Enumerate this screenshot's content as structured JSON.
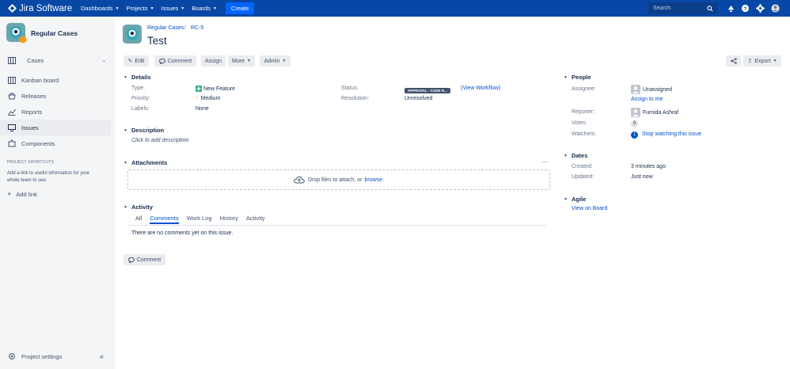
{
  "topbar": {
    "app_title": "Jira Software",
    "nav": [
      "Dashboards",
      "Projects",
      "Issues",
      "Boards"
    ],
    "create_label": "Create",
    "search_placeholder": "Search"
  },
  "sidebar": {
    "project_name": "Regular Cases",
    "items": [
      {
        "label": "Cases"
      },
      {
        "label": "Kanban board"
      },
      {
        "label": "Releases"
      },
      {
        "label": "Reports"
      },
      {
        "label": "Issues"
      },
      {
        "label": "Components"
      }
    ],
    "shortcuts_header": "PROJECT SHORTCUTS",
    "shortcuts_text": "Add a link to useful information for your whole team to see.",
    "add_link": "Add link",
    "settings": "Project settings"
  },
  "breadcrumb": {
    "project": "Regular Cases",
    "separator": "/",
    "issue_key": "RC-5"
  },
  "issue": {
    "title": "Test"
  },
  "toolbar": {
    "edit": "Edit",
    "comment": "Comment",
    "assign": "Assign",
    "more": "More",
    "admin": "Admin",
    "export": "Export"
  },
  "details": {
    "header": "Details",
    "type_label": "Type:",
    "type_value": "New Feature",
    "priority_label": "Priority:",
    "priority_value": "Medium",
    "labels_label": "Labels:",
    "labels_value": "None",
    "status_label": "Status:",
    "status_value": "APPROVAL - CODE R...",
    "view_workflow": "(View Workflow)",
    "resolution_label": "Resolution:",
    "resolution_value": "Unresolved"
  },
  "description": {
    "header": "Description",
    "placeholder": "Click to add description"
  },
  "attachments": {
    "header": "Attachments",
    "drop_text": "Drop files to attach, or",
    "browse": "browse."
  },
  "activity": {
    "header": "Activity",
    "tabs": [
      "All",
      "Comments",
      "Work Log",
      "History",
      "Activity"
    ],
    "empty": "There are no comments yet on this issue.",
    "comment_button": "Comment"
  },
  "people": {
    "header": "People",
    "assignee_label": "Assignee:",
    "assignee_value": "Unassigned",
    "assign_to_me": "Assign to me",
    "reporter_label": "Reporter:",
    "reporter_value": "Fumida Ashraf",
    "votes_label": "Votes:",
    "votes_value": "0",
    "watchers_label": "Watchers:",
    "watchers_value": "1",
    "stop_watching": "Stop watching this issue"
  },
  "dates": {
    "header": "Dates",
    "created_label": "Created:",
    "created_value": "3 minutes ago",
    "updated_label": "Updated:",
    "updated_value": "Just now"
  },
  "agile": {
    "header": "Agile",
    "view_on_board": "View on Board"
  }
}
